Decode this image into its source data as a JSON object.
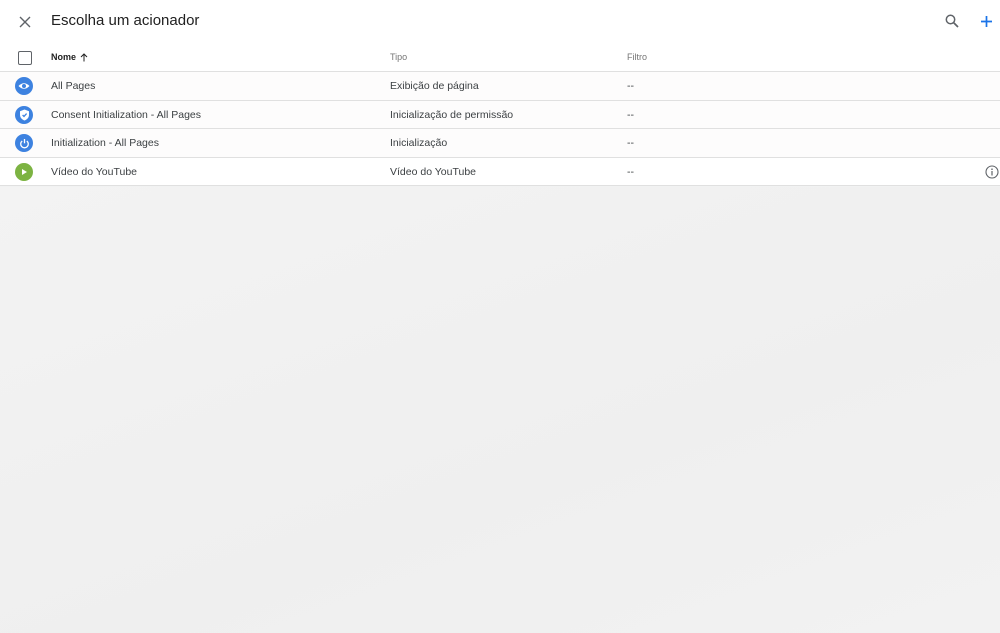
{
  "header": {
    "title": "Escolha um acionador"
  },
  "columns": {
    "name": "Nome",
    "type": "Tipo",
    "filter": "Filtro"
  },
  "rows": [
    {
      "name": "All Pages",
      "type": "Exibição de página",
      "filter": "--",
      "icon": "eye-icon",
      "color": "#3d82e0"
    },
    {
      "name": "Consent Initialization - All Pages",
      "type": "Inicialização de permissão",
      "filter": "--",
      "icon": "shield-icon",
      "color": "#3d82e0"
    },
    {
      "name": "Initialization - All Pages",
      "type": "Inicialização",
      "filter": "--",
      "icon": "power-icon",
      "color": "#3d82e0"
    },
    {
      "name": "Vídeo do YouTube",
      "type": "Vídeo do YouTube",
      "filter": "--",
      "icon": "play-icon",
      "color": "#7cb342"
    }
  ],
  "colors": {
    "accent": "#1a73e8",
    "blue_icon": "#3d82e0",
    "green_icon": "#7cb342"
  }
}
